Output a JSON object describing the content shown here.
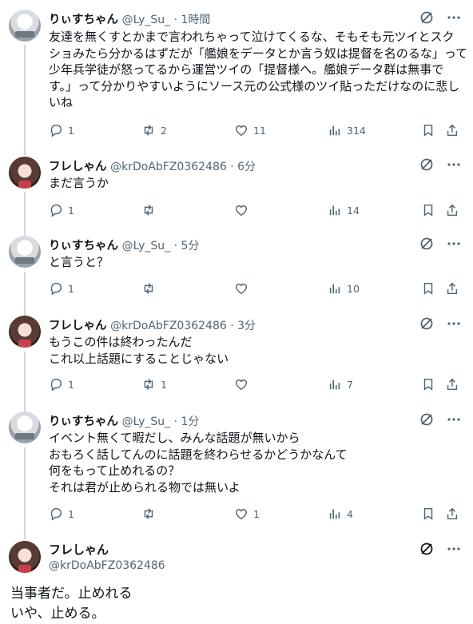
{
  "tweets": [
    {
      "name": "りぃすちゃん",
      "handle": "@Ly_Su_ · 1時間",
      "lines": [
        "友達を無くすとかまで言われちゃって泣けてくるな、そもそも元ツイとスク",
        "ショみたら分かるはずだが「艦娘をデータとか言う奴は提督を名のるな」って",
        "少年兵学徒が怒ってるから運営ツイの「提督様へ。艦娘データ群は無事で",
        "す。」って分かりやすいようにソース元の公式様のツイ貼っただけなのに悲し",
        "いね"
      ],
      "replies": "1",
      "retweets": "2",
      "likes": "11",
      "views": "314"
    },
    {
      "name": "フレしゃん",
      "handle": "@krDoAbFZ0362486 · 6分",
      "lines": [
        "まだ言うか"
      ],
      "replies": "1",
      "retweets": "",
      "likes": "",
      "views": "14"
    },
    {
      "name": "りぃすちゃん",
      "handle": "@Ly_Su_ · 5分",
      "lines": [
        "と言うと？"
      ],
      "replies": "1",
      "retweets": "",
      "likes": "",
      "views": "10"
    },
    {
      "name": "フレしゃん",
      "handle": "@krDoAbFZ0362486 · 3分",
      "lines": [
        "もうこの件は終わったんだ",
        "これ以上話題にすることじゃない"
      ],
      "replies": "1",
      "retweets": "1",
      "likes": "",
      "views": "7"
    },
    {
      "name": "りぃすちゃん",
      "handle": "@Ly_Su_ · 1分",
      "lines": [
        "イベント無くて暇だし、みんな話題が無いから",
        "おもろく話してんのに話題を終わらせるかどうかなんて",
        "何をもって止めれるの？",
        "それは君が止められる物では無いよ"
      ],
      "replies": "1",
      "retweets": "",
      "likes": "1",
      "views": "4"
    }
  ],
  "main_tweet": {
    "name": "フレしゃん",
    "handle": "@krDoAbFZ0362486",
    "lines": [
      "当事者だ。止めれる",
      "いや、止める。"
    ]
  },
  "icons": {
    "reply": "reply-icon",
    "retweet": "retweet-icon",
    "like": "heart-icon",
    "views": "views-icon",
    "bookmark": "bookmark-icon",
    "share": "share-icon",
    "grok": "grok-icon",
    "more": "more-icon"
  },
  "colors": {
    "text": "#0f1419",
    "muted": "#536471",
    "line": "#cfd9de"
  }
}
